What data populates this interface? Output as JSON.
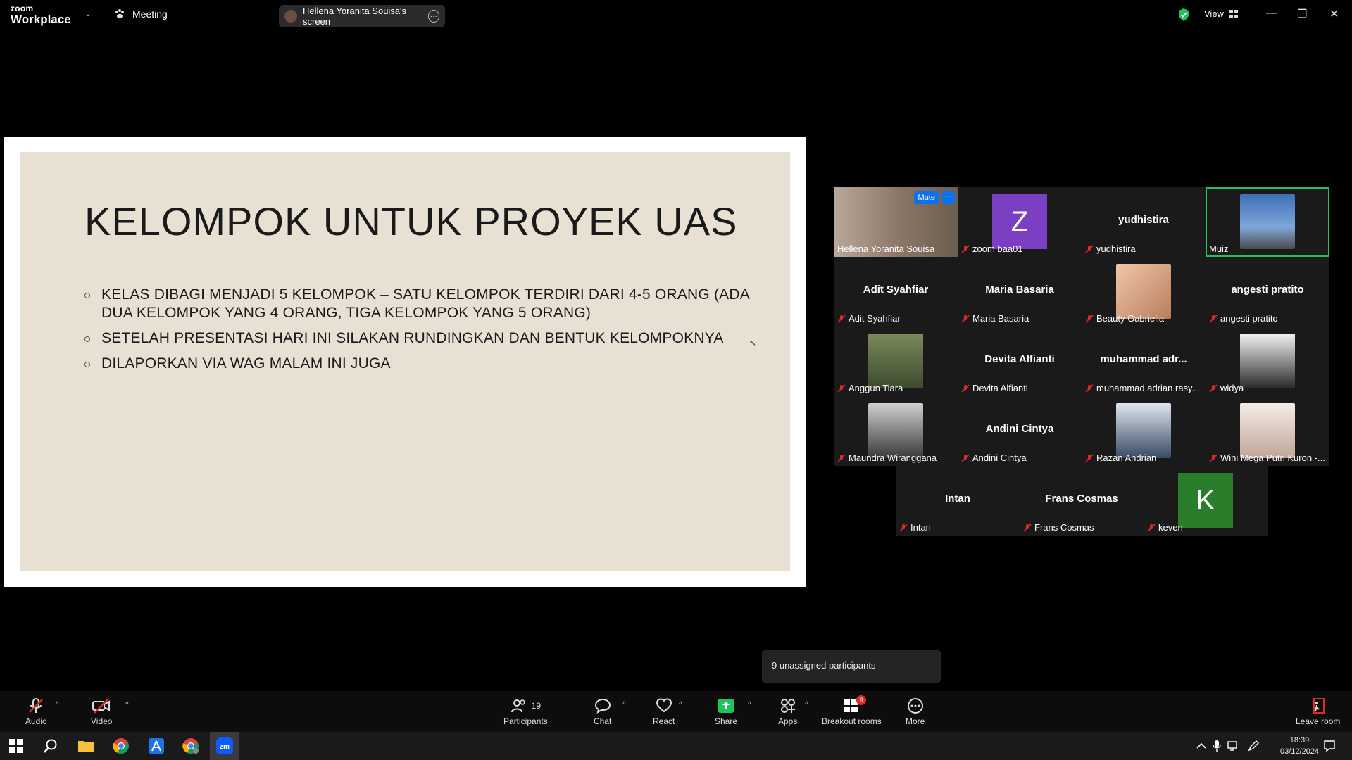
{
  "titlebar": {
    "logo_line1": "zoom",
    "logo_line2": "Workplace",
    "meeting_label": "Meeting",
    "screen_share_label": "Hellena Yoranita Souisa's screen",
    "view_label": "View"
  },
  "slide": {
    "title": "KELOMPOK UNTUK PROYEK UAS",
    "bullets": [
      "KELAS DIBAGI MENJADI 5 KELOMPOK – SATU KELOMPOK TERDIRI DARI 4-5 ORANG (ADA DUA KELOMPOK YANG 4 ORANG, TIGA KELOMPOK YANG 5 ORANG)",
      "SETELAH PRESENTASI HARI INI SILAKAN RUNDINGKAN DAN BENTUK KELOMPOKNYA",
      "DILAPORKAN VIA WAG MALAM INI JUGA"
    ]
  },
  "gallery": {
    "mute_label": "Mute",
    "tiles": [
      {
        "name": "Hellena Yoranita Souisa",
        "center": "",
        "letter": "",
        "muted": false
      },
      {
        "name": "zoom baa01",
        "center": "",
        "letter": "Z",
        "muted": true
      },
      {
        "name": "yudhistira",
        "center": "yudhistira",
        "letter": "",
        "muted": true
      },
      {
        "name": "Muiz",
        "center": "",
        "letter": "",
        "muted": false
      },
      {
        "name": "Adit Syahfiar",
        "center": "Adit Syahfiar",
        "letter": "",
        "muted": true
      },
      {
        "name": "Maria Basaria",
        "center": "Maria Basaria",
        "letter": "",
        "muted": true
      },
      {
        "name": "Beauty Gabriella",
        "center": "",
        "letter": "",
        "muted": true
      },
      {
        "name": "angesti pratito",
        "center": "angesti pratito",
        "letter": "",
        "muted": true
      },
      {
        "name": "Anggun Tiara",
        "center": "",
        "letter": "",
        "muted": true
      },
      {
        "name": "Devita Alfianti",
        "center": "Devita Alfianti",
        "letter": "",
        "muted": true
      },
      {
        "name": "muhammad adrian rasy...",
        "center": "muhammad  adr...",
        "letter": "",
        "muted": true
      },
      {
        "name": "widya",
        "center": "",
        "letter": "",
        "muted": true
      },
      {
        "name": "Maundra Wiranggana",
        "center": "",
        "letter": "",
        "muted": true
      },
      {
        "name": "Andini Cintya",
        "center": "Andini Cintya",
        "letter": "",
        "muted": true
      },
      {
        "name": "Razan Andrian",
        "center": "",
        "letter": "",
        "muted": true
      },
      {
        "name": "Wini Mega Putri Kuron -...",
        "center": "",
        "letter": "",
        "muted": true
      },
      {
        "name": "Intan",
        "center": "Intan",
        "letter": "",
        "muted": true
      },
      {
        "name": "Frans Cosmas",
        "center": "Frans Cosmas",
        "letter": "",
        "muted": true
      },
      {
        "name": "keven",
        "center": "",
        "letter": "K",
        "muted": true
      }
    ]
  },
  "tooltip": "9 unassigned participants",
  "toolbar": {
    "audio": "Audio",
    "video": "Video",
    "participants": "Participants",
    "participants_count": "19",
    "chat": "Chat",
    "react": "React",
    "share": "Share",
    "apps": "Apps",
    "breakout": "Breakout rooms",
    "breakout_badge": "9",
    "more": "More",
    "leave": "Leave room"
  },
  "taskbar": {
    "time": "18:39",
    "date": "03/12/2024"
  },
  "colors": {
    "accent_blue": "#0e71eb",
    "active_green": "#1ec35a",
    "muted_red": "#e02828",
    "slide_bg": "#e7e0d3"
  }
}
